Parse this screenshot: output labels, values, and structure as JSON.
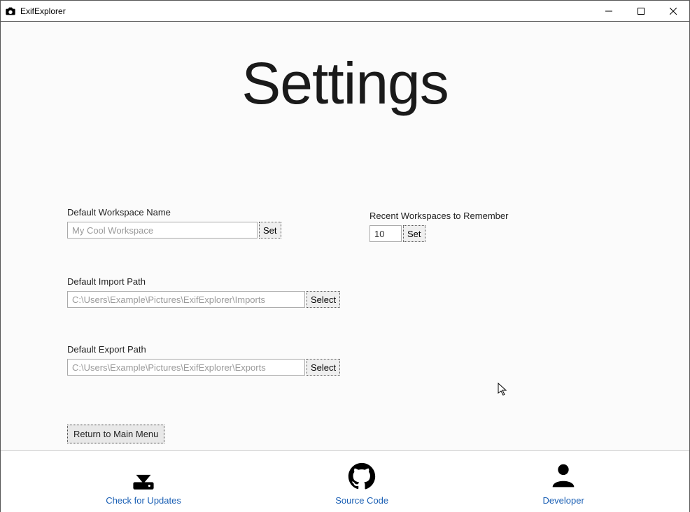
{
  "app": {
    "title": "ExifExplorer"
  },
  "page": {
    "heading": "Settings"
  },
  "settings": {
    "workspace_name": {
      "label": "Default Workspace Name",
      "placeholder": "My Cool Workspace",
      "value": "",
      "button": "Set"
    },
    "recent": {
      "label": "Recent Workspaces to Remember",
      "value": "10",
      "button": "Set"
    },
    "import_path": {
      "label": "Default Import Path",
      "placeholder": "C:\\Users\\Example\\Pictures\\ExifExplorer\\Imports",
      "value": "",
      "button": "Select"
    },
    "export_path": {
      "label": "Default Export Path",
      "placeholder": "C:\\Users\\Example\\Pictures\\ExifExplorer\\Exports",
      "value": "",
      "button": "Select"
    },
    "return_button": "Return to Main Menu"
  },
  "footer": {
    "updates": "Check for Updates",
    "source": "Source Code",
    "developer": "Developer"
  }
}
